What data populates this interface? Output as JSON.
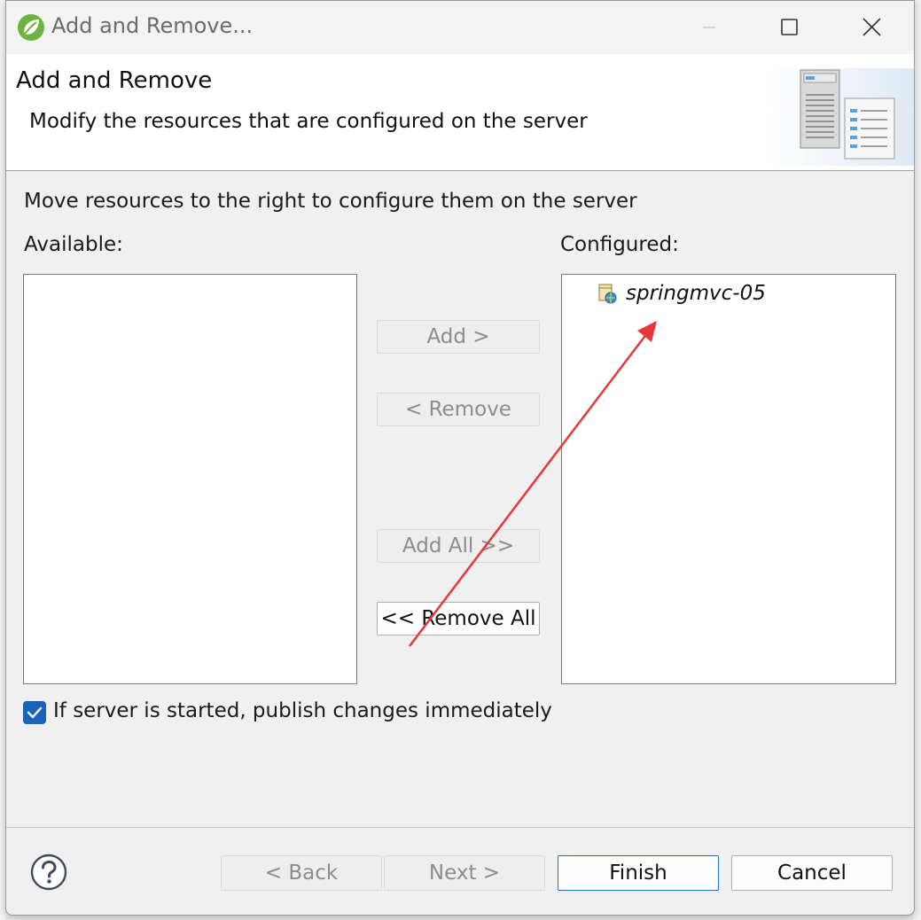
{
  "window": {
    "title": "Add and Remove...",
    "app_icon": "eclipse-spring-leaf-icon"
  },
  "header": {
    "title": "Add and Remove",
    "description": "Modify the resources that are configured on the server",
    "graphic": "server-config-icon"
  },
  "content": {
    "description": "Move resources to the right to configure them on the server",
    "available_label": "Available:",
    "configured_label": "Configured:",
    "available_items": [],
    "configured_items": [
      {
        "label": "springmvc-05",
        "icon": "web-module-icon"
      }
    ]
  },
  "buttons": {
    "add": "Add >",
    "remove": "< Remove",
    "add_all": "Add All >>",
    "remove_all": "<< Remove All"
  },
  "publish_option": {
    "label": "If server is started, publish changes immediately",
    "checked": true
  },
  "footer": {
    "help_icon": "help-icon",
    "back": "< Back",
    "next": "Next >",
    "finish": "Finish",
    "cancel": "Cancel"
  },
  "colors": {
    "accent": "#1a63b8",
    "annotation_arrow": "#e8363a"
  }
}
